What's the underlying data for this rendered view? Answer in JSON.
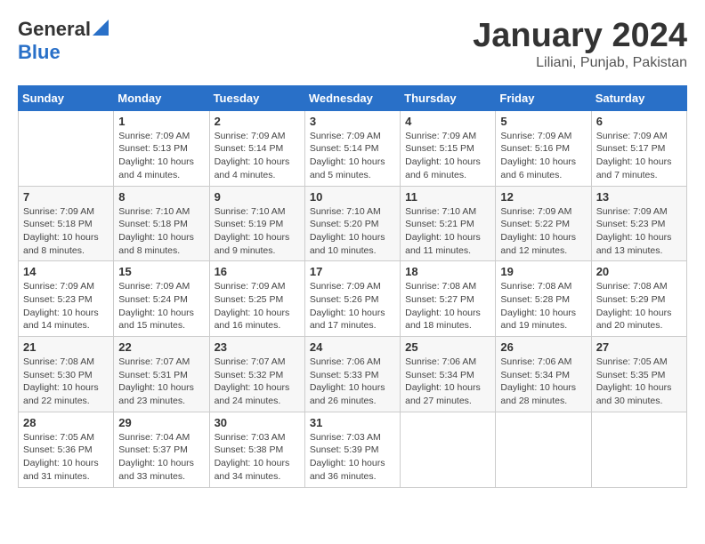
{
  "header": {
    "logo_general": "General",
    "logo_blue": "Blue",
    "month_title": "January 2024",
    "location": "Liliani, Punjab, Pakistan"
  },
  "calendar": {
    "days_of_week": [
      "Sunday",
      "Monday",
      "Tuesday",
      "Wednesday",
      "Thursday",
      "Friday",
      "Saturday"
    ],
    "weeks": [
      [
        {
          "day": "",
          "details": ""
        },
        {
          "day": "1",
          "details": "Sunrise: 7:09 AM\nSunset: 5:13 PM\nDaylight: 10 hours\nand 4 minutes."
        },
        {
          "day": "2",
          "details": "Sunrise: 7:09 AM\nSunset: 5:14 PM\nDaylight: 10 hours\nand 4 minutes."
        },
        {
          "day": "3",
          "details": "Sunrise: 7:09 AM\nSunset: 5:14 PM\nDaylight: 10 hours\nand 5 minutes."
        },
        {
          "day": "4",
          "details": "Sunrise: 7:09 AM\nSunset: 5:15 PM\nDaylight: 10 hours\nand 6 minutes."
        },
        {
          "day": "5",
          "details": "Sunrise: 7:09 AM\nSunset: 5:16 PM\nDaylight: 10 hours\nand 6 minutes."
        },
        {
          "day": "6",
          "details": "Sunrise: 7:09 AM\nSunset: 5:17 PM\nDaylight: 10 hours\nand 7 minutes."
        }
      ],
      [
        {
          "day": "7",
          "details": "Sunrise: 7:09 AM\nSunset: 5:18 PM\nDaylight: 10 hours\nand 8 minutes."
        },
        {
          "day": "8",
          "details": "Sunrise: 7:10 AM\nSunset: 5:18 PM\nDaylight: 10 hours\nand 8 minutes."
        },
        {
          "day": "9",
          "details": "Sunrise: 7:10 AM\nSunset: 5:19 PM\nDaylight: 10 hours\nand 9 minutes."
        },
        {
          "day": "10",
          "details": "Sunrise: 7:10 AM\nSunset: 5:20 PM\nDaylight: 10 hours\nand 10 minutes."
        },
        {
          "day": "11",
          "details": "Sunrise: 7:10 AM\nSunset: 5:21 PM\nDaylight: 10 hours\nand 11 minutes."
        },
        {
          "day": "12",
          "details": "Sunrise: 7:09 AM\nSunset: 5:22 PM\nDaylight: 10 hours\nand 12 minutes."
        },
        {
          "day": "13",
          "details": "Sunrise: 7:09 AM\nSunset: 5:23 PM\nDaylight: 10 hours\nand 13 minutes."
        }
      ],
      [
        {
          "day": "14",
          "details": "Sunrise: 7:09 AM\nSunset: 5:23 PM\nDaylight: 10 hours\nand 14 minutes."
        },
        {
          "day": "15",
          "details": "Sunrise: 7:09 AM\nSunset: 5:24 PM\nDaylight: 10 hours\nand 15 minutes."
        },
        {
          "day": "16",
          "details": "Sunrise: 7:09 AM\nSunset: 5:25 PM\nDaylight: 10 hours\nand 16 minutes."
        },
        {
          "day": "17",
          "details": "Sunrise: 7:09 AM\nSunset: 5:26 PM\nDaylight: 10 hours\nand 17 minutes."
        },
        {
          "day": "18",
          "details": "Sunrise: 7:08 AM\nSunset: 5:27 PM\nDaylight: 10 hours\nand 18 minutes."
        },
        {
          "day": "19",
          "details": "Sunrise: 7:08 AM\nSunset: 5:28 PM\nDaylight: 10 hours\nand 19 minutes."
        },
        {
          "day": "20",
          "details": "Sunrise: 7:08 AM\nSunset: 5:29 PM\nDaylight: 10 hours\nand 20 minutes."
        }
      ],
      [
        {
          "day": "21",
          "details": "Sunrise: 7:08 AM\nSunset: 5:30 PM\nDaylight: 10 hours\nand 22 minutes."
        },
        {
          "day": "22",
          "details": "Sunrise: 7:07 AM\nSunset: 5:31 PM\nDaylight: 10 hours\nand 23 minutes."
        },
        {
          "day": "23",
          "details": "Sunrise: 7:07 AM\nSunset: 5:32 PM\nDaylight: 10 hours\nand 24 minutes."
        },
        {
          "day": "24",
          "details": "Sunrise: 7:06 AM\nSunset: 5:33 PM\nDaylight: 10 hours\nand 26 minutes."
        },
        {
          "day": "25",
          "details": "Sunrise: 7:06 AM\nSunset: 5:34 PM\nDaylight: 10 hours\nand 27 minutes."
        },
        {
          "day": "26",
          "details": "Sunrise: 7:06 AM\nSunset: 5:34 PM\nDaylight: 10 hours\nand 28 minutes."
        },
        {
          "day": "27",
          "details": "Sunrise: 7:05 AM\nSunset: 5:35 PM\nDaylight: 10 hours\nand 30 minutes."
        }
      ],
      [
        {
          "day": "28",
          "details": "Sunrise: 7:05 AM\nSunset: 5:36 PM\nDaylight: 10 hours\nand 31 minutes."
        },
        {
          "day": "29",
          "details": "Sunrise: 7:04 AM\nSunset: 5:37 PM\nDaylight: 10 hours\nand 33 minutes."
        },
        {
          "day": "30",
          "details": "Sunrise: 7:03 AM\nSunset: 5:38 PM\nDaylight: 10 hours\nand 34 minutes."
        },
        {
          "day": "31",
          "details": "Sunrise: 7:03 AM\nSunset: 5:39 PM\nDaylight: 10 hours\nand 36 minutes."
        },
        {
          "day": "",
          "details": ""
        },
        {
          "day": "",
          "details": ""
        },
        {
          "day": "",
          "details": ""
        }
      ]
    ]
  }
}
